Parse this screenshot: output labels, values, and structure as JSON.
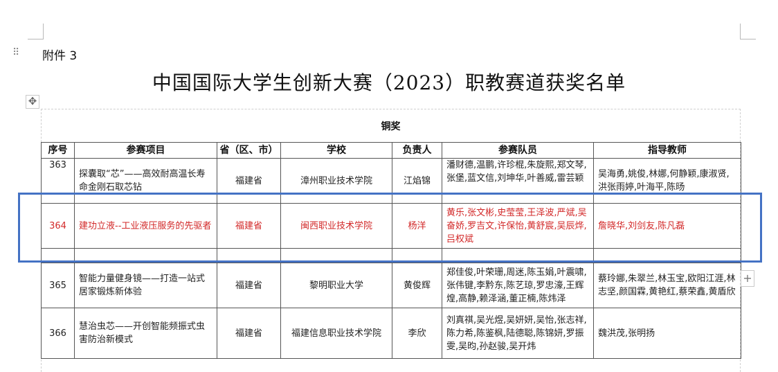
{
  "document": {
    "attachment_label": "附件 3",
    "title": "中国国际大学生创新大赛（2023）职教赛道获奖名单",
    "award_level": "铜奖"
  },
  "table": {
    "headers": [
      "序号",
      "参赛项目",
      "省（区、市）",
      "学校",
      "负责人",
      "参赛队员",
      "指导教师"
    ],
    "rows": [
      {
        "no": "363",
        "project": "探囊取“芯”——高效耐高温长寿命金刚石取芯钻",
        "province": "福建省",
        "school": "漳州职业技术学院",
        "leader": "江焰锦",
        "members": "潘财德,温鹏,许珍棍,朱旋熙,郑文琴,张堡,蓝文信,刘坤华,叶善威,雷芸颖",
        "advisors": "吴海勇,姚俊,林娜,何静颖,康淑贤,洪张雨婷,叶海平,陈旸"
      },
      {
        "no": "364",
        "project": "建功立液--工业液压服务的先驱者",
        "province": "福建省",
        "school": "闽西职业技术学院",
        "leader": "杨洋",
        "members": "黄乐,张文彬,史莹莹,王泽波,严斌,吴奋娇,罗吉文,许保怡,黄舒宸,吴辰烨,吕权斌",
        "advisors": "詹晓华,刘剑友,陈凡磊"
      },
      {
        "no": "365",
        "project": "智能力量健身镜——打造一站式居家锻炼新体验",
        "province": "福建省",
        "school": "黎明职业大学",
        "leader": "黄俊辉",
        "members": "郑佳俊,叶荣珊,周迷,陈玉娟,叶震啸,张伟键,李黔东,陈艺琼,罗忠濠,王辉煌,高静,赖泽涵,董正楠,陈炜泽",
        "advisors": "蔡玲娜,朱翠兰,林玉宝,欧阳江涯,林志坚,颜国霖,黄艳红,蔡荣鑫,黄盾欣"
      },
      {
        "no": "366",
        "project": "慧治虫芯——开创智能频振式虫害防治新模式",
        "province": "福建省",
        "school": "福建信息职业技术学院",
        "leader": "李欣",
        "members": "刘真祺,吴光煜,吴妍妍,吴怡,张志祥,陈力希,陈鉴枫,陆德聪,陈锦妍,罗振雯,吴昀,孙赵骏,吴开炜",
        "advisors": "魏洪茂,张明扬"
      }
    ]
  }
}
